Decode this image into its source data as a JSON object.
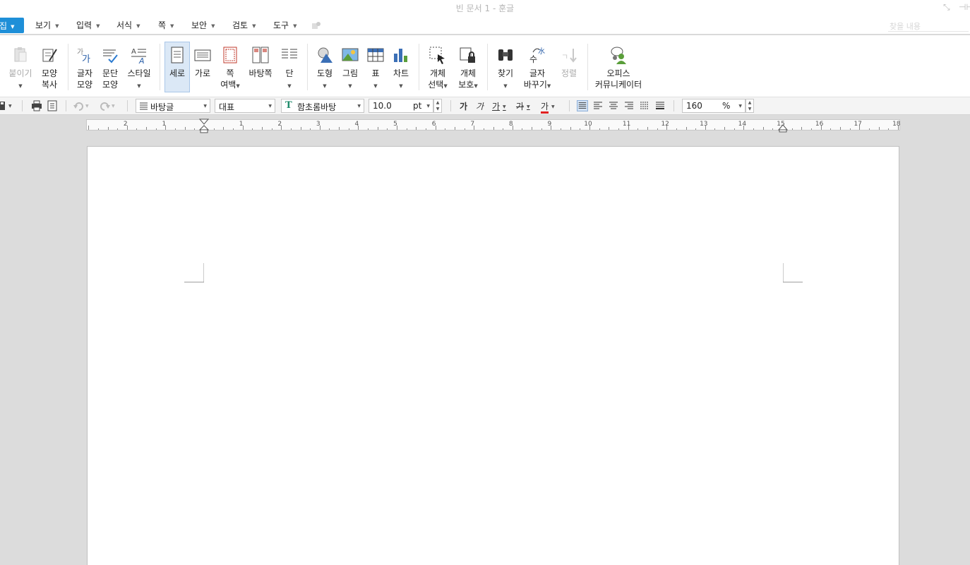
{
  "window": {
    "title": "빈 문서 1 - 훈글",
    "controls": [
      "⤡",
      "⊣⊢"
    ]
  },
  "menubar": {
    "edit": "편집",
    "items": [
      {
        "label": "보기"
      },
      {
        "label": "입력"
      },
      {
        "label": "서식"
      },
      {
        "label": "쪽"
      },
      {
        "label": "보안"
      },
      {
        "label": "검토"
      },
      {
        "label": "도구"
      }
    ],
    "search_placeholder": "찾을 내용"
  },
  "ribbon": {
    "paste": {
      "line1": "붙이기",
      "disabled": true
    },
    "format_copy": {
      "line1": "모양",
      "line2": "복사"
    },
    "char_shape": {
      "line1": "글자",
      "line2": "모양"
    },
    "para_shape": {
      "line1": "문단",
      "line2": "모양"
    },
    "style": {
      "line1": "스타일"
    },
    "portrait": {
      "line1": "세로",
      "active": true
    },
    "landscape": {
      "line1": "가로"
    },
    "margins": {
      "line1": "쪽",
      "line2": "여백"
    },
    "background": {
      "line1": "바탕쪽"
    },
    "columns": {
      "line1": "단"
    },
    "shapes": {
      "line1": "도형"
    },
    "picture": {
      "line1": "그림"
    },
    "table": {
      "line1": "표"
    },
    "chart": {
      "line1": "차트"
    },
    "select_obj": {
      "line1": "개체",
      "line2": "선택"
    },
    "protect_obj": {
      "line1": "개체",
      "line2": "보호"
    },
    "find": {
      "line1": "찾기"
    },
    "replace": {
      "line1": "글자",
      "line2": "바꾸기"
    },
    "sort": {
      "line1": "정렬",
      "disabled": true
    },
    "office": {
      "line1": "오피스",
      "line2": "커뮤니케이터"
    }
  },
  "formatbar": {
    "style_value": "바탕글",
    "lang_value": "대표",
    "font_value": "함초롬바탕",
    "size_value": "10.0",
    "size_unit": "pt",
    "bold_glyph": "가",
    "italic_glyph": "가",
    "underline_glyph": "가",
    "strike_glyph": "가",
    "color_glyph": "가",
    "zoom_value": "160",
    "zoom_unit": "%"
  },
  "ruler": {
    "labels": [
      "2",
      "1",
      "1",
      "2",
      "3",
      "4",
      "5",
      "6",
      "7",
      "8",
      "9",
      "10",
      "11",
      "12",
      "13",
      "14",
      "15",
      "16",
      "17",
      "18"
    ]
  },
  "colors": {
    "accent": "#1e8fd8",
    "active_bg": "#dbe8f6",
    "workspace": "#dcdcdc"
  }
}
